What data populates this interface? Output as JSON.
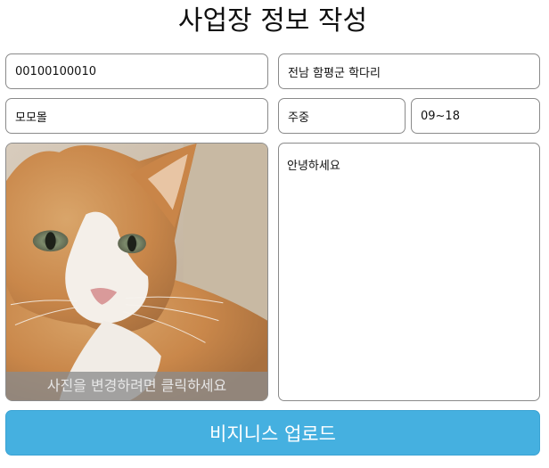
{
  "page": {
    "title": "사업장 정보 작성"
  },
  "form": {
    "registration_number": "00100100010",
    "address": "전남 함평군 학다리",
    "business_name": "모모몰",
    "business_days": "주중",
    "business_hours": "09~18",
    "description": "안녕하세요"
  },
  "photo": {
    "caption": "사진을 변경하려면 클릭하세요",
    "subject": "orange-white cat"
  },
  "submit": {
    "label": "비지니스 업로드"
  },
  "colors": {
    "accent": "#45b0e0",
    "border": "#8a8a8a"
  }
}
